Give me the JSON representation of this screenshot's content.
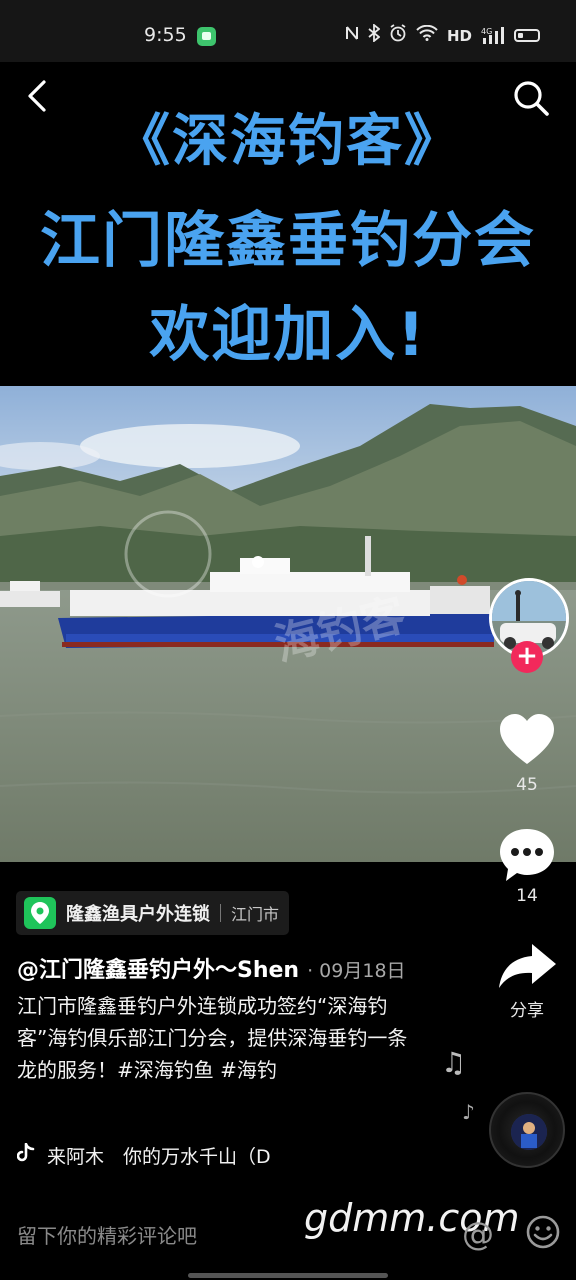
{
  "status_bar": {
    "time": "9:55",
    "network_label": "HD",
    "signal_label": "4G",
    "icons": [
      "nfc-icon",
      "bluetooth-icon",
      "alarm-icon",
      "wifi-icon",
      "signal-icon",
      "battery-icon"
    ]
  },
  "video": {
    "title_lines": [
      "《深海钓客》",
      "江门隆鑫垂钓分会",
      "欢迎加入!"
    ],
    "title_color": "#4aa3f0"
  },
  "actions": {
    "like_count": "45",
    "comment_count": "14",
    "share_label": "分享"
  },
  "post": {
    "location_name": "隆鑫渔具户外连锁",
    "location_city": "江门市",
    "author": "@江门隆鑫垂钓户外～Shen",
    "date": "· 09月18日",
    "caption": "江门市隆鑫垂钓户外连锁成功签约“深海钓客”海钓俱乐部江门分会，提供深海垂钓一条龙的服务！#深海钓鱼 #海钓",
    "music": "来阿木　你的万水千山（D"
  },
  "comment_bar": {
    "placeholder": "留下你的精彩评论吧",
    "at_symbol": "@"
  },
  "watermark": "gdmm.com",
  "colors": {
    "follow": "#f2295b",
    "location_pin": "#1fc45a"
  }
}
